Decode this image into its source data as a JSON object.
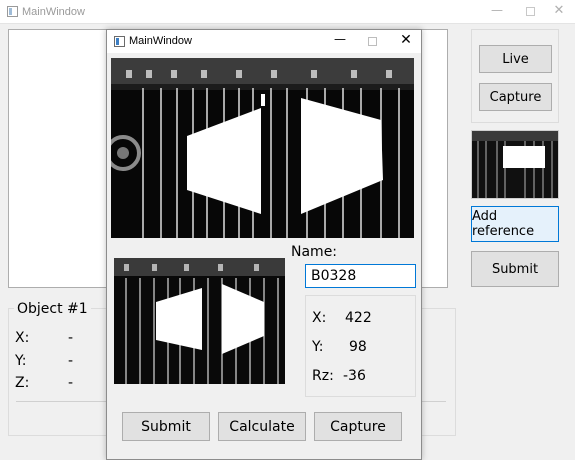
{
  "back_window": {
    "title": "MainWindow",
    "buttons": {
      "live": "Live",
      "capture": "Capture",
      "add_reference": "Add reference",
      "submit": "Submit"
    },
    "object_group": {
      "title": "Object #1",
      "x_label": "X:",
      "x_value": "-",
      "y_label": "Y:",
      "y_value": "-",
      "z_label": "Z:",
      "z_value": "-"
    }
  },
  "dialog": {
    "title": "MainWindow",
    "name_label": "Name:",
    "name_value": "B0328",
    "x_label": "X:",
    "x_value": "422",
    "y_label": "Y:",
    "y_value": "98",
    "rz_label": "Rz:",
    "rz_value": "-36",
    "buttons": {
      "submit": "Submit",
      "calculate": "Calculate",
      "capture": "Capture"
    }
  },
  "icons": {
    "window_controls": [
      "minimize-icon",
      "maximize-icon",
      "close-icon"
    ],
    "app": "app-window-icon"
  }
}
